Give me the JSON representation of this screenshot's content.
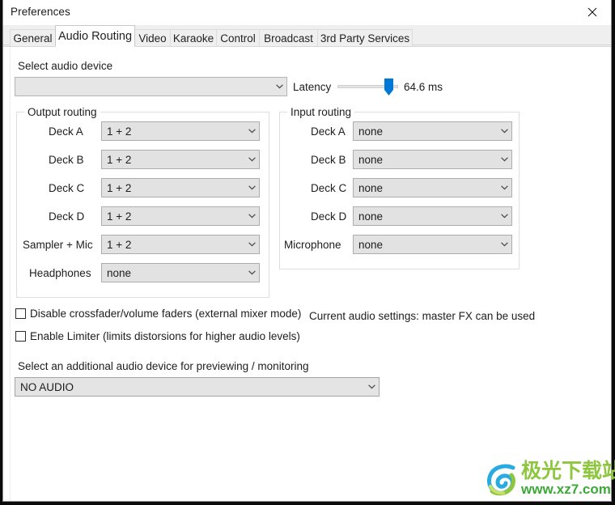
{
  "window": {
    "title": "Preferences",
    "close_icon": "close-icon"
  },
  "tabs": [
    {
      "label": "General",
      "selected": false
    },
    {
      "label": "Audio Routing",
      "selected": true
    },
    {
      "label": "Video",
      "selected": false
    },
    {
      "label": "Karaoke",
      "selected": false
    },
    {
      "label": "Control",
      "selected": false
    },
    {
      "label": "Broadcast",
      "selected": false
    },
    {
      "label": "3rd Party Services",
      "selected": false
    }
  ],
  "audio_device": {
    "label": "Select audio device",
    "value": "",
    "placeholder": ""
  },
  "latency": {
    "label": "Latency",
    "value_text": "64.6 ms",
    "value": 64.6,
    "percent": 90
  },
  "output_routing": {
    "title": "Output routing",
    "rows": [
      {
        "label": "Deck A",
        "value": "1 + 2"
      },
      {
        "label": "Deck B",
        "value": "1 + 2"
      },
      {
        "label": "Deck C",
        "value": "1 + 2"
      },
      {
        "label": "Deck D",
        "value": "1 + 2"
      },
      {
        "label": "Sampler + Mic",
        "value": "1 + 2"
      },
      {
        "label": "Headphones",
        "value": "none"
      }
    ]
  },
  "input_routing": {
    "title": "Input routing",
    "rows": [
      {
        "label": "Deck A",
        "value": "none"
      },
      {
        "label": "Deck B",
        "value": "none"
      },
      {
        "label": "Deck C",
        "value": "none"
      },
      {
        "label": "Deck D",
        "value": "none"
      },
      {
        "label": "Microphone",
        "value": "none"
      }
    ]
  },
  "options": {
    "disable_crossfader": {
      "label": "Disable crossfader/volume faders (external mixer mode)",
      "checked": false
    },
    "enable_limiter": {
      "label": "Enable Limiter (limits distorsions for higher audio levels)",
      "checked": false
    }
  },
  "status": {
    "current_audio_settings": "Current audio settings: master FX can be used"
  },
  "preview_device": {
    "label": "Select an additional audio device for previewing / monitoring",
    "value": "NO AUDIO"
  },
  "watermark": {
    "cn_text": "极光下载站",
    "url_text": "www.xz7.com",
    "logo_icon": "swirl-logo-icon",
    "colors": {
      "cn": "#8ec63f",
      "url": "#3aaa35",
      "logo_blue": "#29abe2",
      "logo_green": "#8ec63f"
    }
  },
  "colors": {
    "accent": "#0078d7",
    "combo_bg": "#e2e2e2",
    "panel_bg": "#ffffff",
    "tabstrip_bg": "#efefef"
  }
}
